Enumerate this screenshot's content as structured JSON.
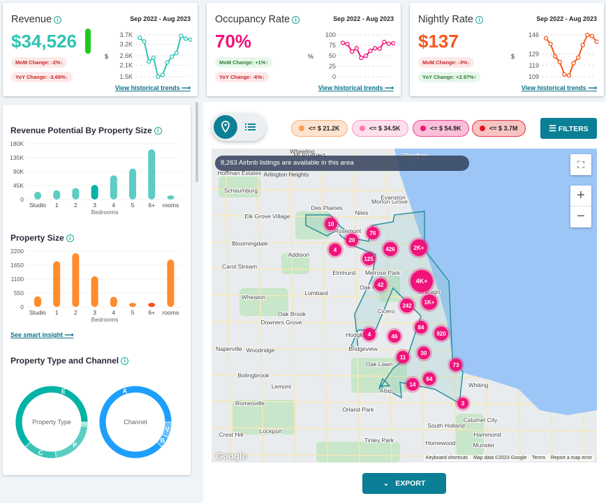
{
  "cards": [
    {
      "title": "Revenue",
      "range": "Sep 2022 - Aug 2023",
      "value": "$34,526",
      "color": "#2ec4b0",
      "mom": "MoM Change: -2%↓",
      "mom_dir": "neg",
      "yoy": "YoY Change: -3.69%↓",
      "yoy_dir": "neg",
      "unit": "$",
      "ticks": [
        "3.7K",
        "3.2K",
        "2.6K",
        "2.1K",
        "1.5K"
      ],
      "tick_values": [
        3.7,
        3.2,
        2.6,
        2.1,
        1.5
      ],
      "series": [
        3.55,
        3.35,
        2.3,
        2.5,
        1.5,
        1.6,
        2.25,
        2.55,
        2.75,
        3.65,
        3.5,
        3.45
      ],
      "link": "View historical trends ⟶",
      "indicator_color": "#1ec91e"
    },
    {
      "title": "Occupancy Rate",
      "range": "Sep 2022 - Aug 2023",
      "value": "70%",
      "color": "#f0137a",
      "mom": "MoM Change: +1%↑",
      "mom_dir": "pos",
      "yoy": "YoY Change: -6%↓",
      "yoy_dir": "neg",
      "unit": "%",
      "ticks": [
        "100",
        "75",
        "50",
        "25",
        "0"
      ],
      "tick_values": [
        100,
        75,
        50,
        25,
        0
      ],
      "series": [
        81,
        78,
        60,
        68,
        45,
        50,
        62,
        68,
        67,
        83,
        79,
        80
      ],
      "link": "View historical trends ⟶"
    },
    {
      "title": "Nightly Rate",
      "range": "Sep 2022 - Aug 2023",
      "value": "$137",
      "color": "#f7561a",
      "mom": "MoM Change: -3%↓",
      "mom_dir": "neg",
      "yoy": "YoY Change: +2.97%↑",
      "yoy_dir": "pos",
      "unit": "$",
      "ticks": [
        "146",
        "129",
        "119",
        "109"
      ],
      "tick_values": [
        146,
        129,
        119,
        109
      ],
      "series": [
        143,
        138,
        127,
        122,
        111,
        110,
        121,
        126,
        137,
        146,
        145,
        140
      ],
      "link": "View historical trends ⟶"
    }
  ],
  "chart_data": [
    {
      "type": "bar",
      "title": "Revenue Potential By Property Size",
      "xlabel": "Bedrooms",
      "categories": [
        "Studio",
        "1",
        "2",
        "3",
        "4",
        "5",
        "6+",
        "rooms"
      ],
      "values": [
        25000,
        30000,
        37000,
        47000,
        78000,
        100000,
        162000,
        12000
      ],
      "yticks": [
        "180K",
        "135K",
        "90K",
        "45K",
        "0"
      ],
      "ylim": [
        0,
        180000
      ],
      "color": "#5ccdc3",
      "highlight_color": "#00b3a6",
      "highlight": "3"
    },
    {
      "type": "bar",
      "title": "Property Size",
      "xlabel": "Bedrooms",
      "categories": [
        "Studio",
        "1",
        "2",
        "3",
        "4",
        "5",
        "6+",
        "rooms"
      ],
      "values": [
        420,
        1800,
        2120,
        1210,
        400,
        90,
        60,
        1870
      ],
      "yticks": [
        "2200",
        "1650",
        "1100",
        "550",
        "0"
      ],
      "ylim": [
        0,
        2200
      ],
      "color": "#ff8c2e",
      "highlight_color": "#f4511e",
      "highlight": "6+"
    },
    {
      "type": "pie",
      "title": "Property Type",
      "center": "Property Type",
      "slices": [
        {
          "label": "E",
          "value": 62,
          "color": "#00b3a6"
        },
        {
          "label": "C",
          "value": 15,
          "color": "#3cc3b6"
        },
        {
          "label": "P",
          "value": 21,
          "color": "#5ccdc3"
        },
        {
          "label": "",
          "value": 1,
          "color": "#7fd8cf"
        },
        {
          "label": "",
          "value": 1,
          "color": "#a0e2db"
        }
      ]
    },
    {
      "type": "pie",
      "title": "Channel",
      "center": "Channel",
      "slices": [
        {
          "label": "A",
          "value": 88,
          "color": "#1e9ffb"
        },
        {
          "label": "B",
          "value": 5,
          "color": "#45b0fb"
        },
        {
          "label": "V",
          "value": 7,
          "color": "#6ec1fc"
        }
      ]
    }
  ],
  "left": {
    "smart_insight": "See smart insight ⟶",
    "type_channel_title": "Property Type and Channel"
  },
  "legend": [
    {
      "label": "<= $ 21.2K",
      "dot": "#ff9a52",
      "bg": "#fde3d0",
      "border": "#f7b07a"
    },
    {
      "label": "<= $ 34.5K",
      "dot": "#ff77b0",
      "bg": "#fde0ec",
      "border": "#f59ac2"
    },
    {
      "label": "<= $ 54.9K",
      "dot": "#f0137a",
      "bg": "#fbbfd9",
      "border": "#f0408f"
    },
    {
      "label": "<= $ 3.7M",
      "dot": "#e8101a",
      "bg": "#f8c3c3",
      "border": "#e0303a"
    }
  ],
  "filters_label": "FILTERS",
  "map": {
    "banner": "8,263 Airbnb listings are available in this area",
    "markers": [
      "10",
      "4",
      "20",
      "76",
      "426",
      "2K+",
      "125",
      "4K+",
      "42",
      "1K+",
      "242",
      "84",
      "920",
      "4",
      "46",
      "30",
      "11",
      "73",
      "64",
      "14",
      "3"
    ],
    "places": [
      "Wheeling",
      "Arlington Heights",
      "Mt Prospect",
      "Glenview",
      "Hoffman Estates",
      "Schaumburg",
      "Des Plaines",
      "Morton Grove",
      "Evanston",
      "Niles",
      "Elk Grove Village",
      "Rosemont",
      "Bloomingdale",
      "Addison",
      "Carol Stream",
      "Elmhurst",
      "Melrose Park",
      "Oak Park",
      "Lombard",
      "Wheaton",
      "Chicago",
      "Cicero",
      "Oak Brook",
      "Downers Grove",
      "Hodgkins",
      "Bridgeview",
      "Naperville",
      "Woodridge",
      "Oak Lawn",
      "Bolingbrook",
      "Lemont",
      "Alsip",
      "Whiting",
      "Romeoville",
      "Orland Park",
      "Calumet City",
      "South Holland",
      "Lockport",
      "Tinley Park",
      "Homewood",
      "Munster",
      "Hammond",
      "Crest Hill"
    ],
    "footer": [
      "Keyboard shortcuts",
      "Map data ©2023 Google",
      "Terms",
      "Report a map error"
    ],
    "google": "Google",
    "plus": "+",
    "minus": "−"
  },
  "export_label": "EXPORT"
}
